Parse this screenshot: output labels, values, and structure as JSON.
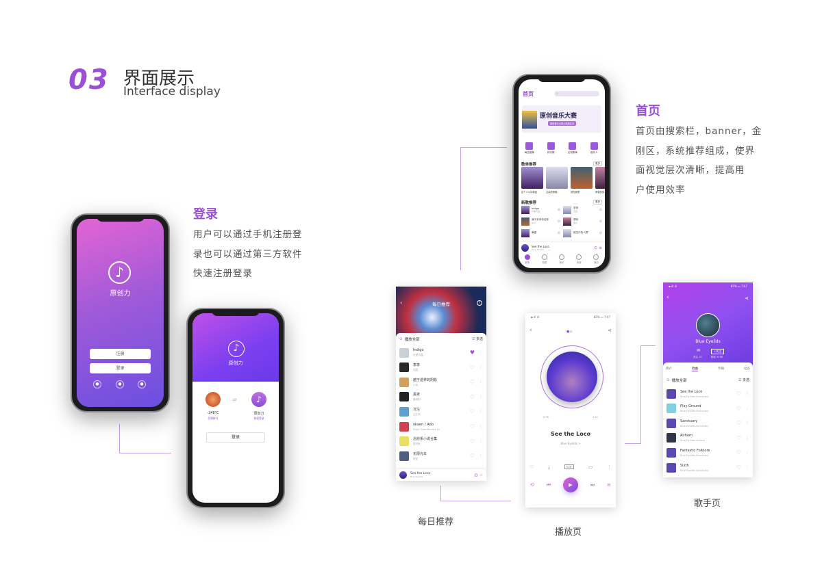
{
  "header": {
    "number": "03",
    "title_cn": "界面展示",
    "title_en": "Interface display"
  },
  "colors": {
    "accent": "#9a4fd6",
    "gradient_start": "#e464d4",
    "gradient_end": "#6a4fe0"
  },
  "login_section": {
    "title": "登录",
    "desc": [
      "用户可以通过手机注册登",
      "录也可以通过第三方软件",
      "快速注册登录"
    ]
  },
  "home_section": {
    "title": "首页",
    "desc": [
      "首页由搜索栏，banner，金",
      "刚区，系统推荐组成，使界",
      "面视觉层次清晰，提高用",
      "户使用效率"
    ]
  },
  "captions": {
    "daily": "每日推荐",
    "player": "播放页",
    "artist": "歌手页"
  },
  "login": {
    "app_name": "原创力",
    "register": "注册",
    "login": "登录",
    "social_icons": [
      "wechat-icon",
      "qq-icon",
      "weibo-icon"
    ]
  },
  "auth": {
    "app_name": "原创力",
    "user_name": "-248°C",
    "user_sub": "切换帐号",
    "app_label": "原创力",
    "app_sub": "授权登录",
    "login": "登录"
  },
  "home": {
    "title": "首页",
    "search_placeholder": "",
    "banner_title": "原创音乐大赛",
    "banner_sub": "原创音乐大赛火热报名中",
    "quick": [
      {
        "label": "每日推荐",
        "icon": "star-bookmark-icon"
      },
      {
        "label": "排行榜",
        "icon": "trophy-icon"
      },
      {
        "label": "交流歌单",
        "icon": "list-icon"
      },
      {
        "label": "音乐人",
        "icon": "person-icon"
      }
    ],
    "playlist_title": "歌单推荐",
    "more": "更多",
    "playlists": [
      "这个人小清新品",
      "云朵的夜晚",
      "就在那里",
      "黄昏的街"
    ],
    "new_title": "新歌推荐",
    "more2": "更多",
    "new_songs": [
      {
        "t": "Indigo",
        "s": "汉堡与猫"
      },
      {
        "t": "李李",
        "s": "花园"
      },
      {
        "t": "我于未来勾住你",
        "s": "Bird"
      },
      {
        "t": "想你",
        "s": "夜光"
      },
      {
        "t": "黄昏",
        "s": ""
      },
      {
        "t": "夜空中的人群",
        "s": ""
      }
    ],
    "mini": {
      "title": "See the Loco",
      "artist": "Blue Eyelids"
    },
    "tabs": [
      "发现",
      "视频",
      "音乐",
      "商城",
      "我的"
    ]
  },
  "daily": {
    "title": "每日推荐",
    "play_all": "播放全部",
    "multi": "多选",
    "songs": [
      {
        "t": "Indigo",
        "s": "汉堡与猫",
        "liked": true
      },
      {
        "t": "李李",
        "s": "花园",
        "liked": false
      },
      {
        "t": "越于遗界的阴影",
        "s": "小安",
        "liked": false
      },
      {
        "t": "黑夜",
        "s": "董咸阿",
        "liked": false
      },
      {
        "t": "沉沦",
        "s": "江孔阿",
        "liked": false
      },
      {
        "t": "okaeri / Ado",
        "s": "Rokei Tribe/Niclaes Lu",
        "liked": false
      },
      {
        "t": "治愈系小说合集",
        "s": "银河系",
        "liked": false
      },
      {
        "t": "无限光年",
        "s": "阿花",
        "liked": false
      }
    ],
    "mini": {
      "title": "See the Loco",
      "artist": "Blue Eyelids"
    }
  },
  "player": {
    "title": "See the Loco",
    "artist": "Blue Eyelids >",
    "time_current": "0:38",
    "time_total": "3:22",
    "quality": "标准",
    "progress": 0.2
  },
  "artist": {
    "name": "Blue Eyelids",
    "follow": "+关注",
    "following": "关注 15",
    "fans": "粉丝 3456",
    "tabs": [
      "简介",
      "歌曲",
      "专辑",
      "动态"
    ],
    "active_tab": 1,
    "play_all": "播放全部",
    "multi": "多选",
    "songs": [
      {
        "t": "See the Loco",
        "s": "Blue Eyelids-Sanctuary"
      },
      {
        "t": "Play Ground",
        "s": "Blue Eyelids-Sanctuary"
      },
      {
        "t": "Sanctuary",
        "s": "Blue Eyelids-Sanctuary"
      },
      {
        "t": "Airhorn",
        "s": "Blue Eyelids-Airhorn"
      },
      {
        "t": "Fantastic Folklore",
        "s": "Blue Eyelids-Sanctuary"
      },
      {
        "t": "Sixth",
        "s": "Blue Eyelids-Sanctuary"
      }
    ]
  }
}
